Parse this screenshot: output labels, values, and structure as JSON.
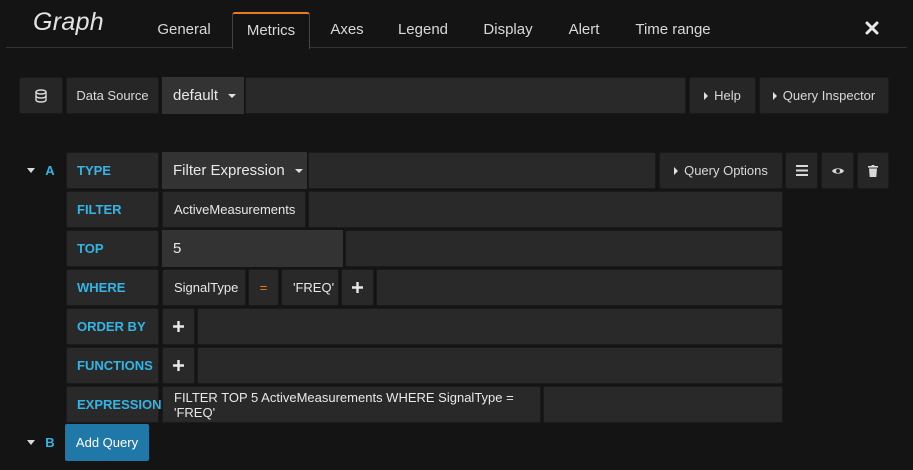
{
  "panel": {
    "title": "Graph"
  },
  "tabs": [
    {
      "label": "General"
    },
    {
      "label": "Metrics"
    },
    {
      "label": "Axes"
    },
    {
      "label": "Legend"
    },
    {
      "label": "Display"
    },
    {
      "label": "Alert"
    },
    {
      "label": "Time range"
    }
  ],
  "active_tab": "Metrics",
  "accent_color": "#eb7b18",
  "label_color": "#33b5e5",
  "close_icon": "close-icon",
  "datasource": {
    "icon": "database-icon",
    "label": "Data Source",
    "value": "default",
    "help_label": "Help",
    "inspector_label": "Query Inspector"
  },
  "query_a": {
    "letter": "A",
    "type_label": "TYPE",
    "type_value": "Filter Expression",
    "options_label": "Query Options",
    "filter_label": "FILTER",
    "filter_value": "ActiveMeasurements",
    "top_label": "TOP",
    "top_value": "5",
    "where_label": "WHERE",
    "where_field": "SignalType",
    "where_operator": "=",
    "where_value": "'FREQ'",
    "orderby_label": "ORDER BY",
    "functions_label": "FUNCTIONS",
    "expression_label": "EXPRESSION",
    "expression_value": "FILTER TOP 5 ActiveMeasurements WHERE SignalType = 'FREQ'"
  },
  "query_b": {
    "letter": "B"
  },
  "add_query_label": "Add Query"
}
